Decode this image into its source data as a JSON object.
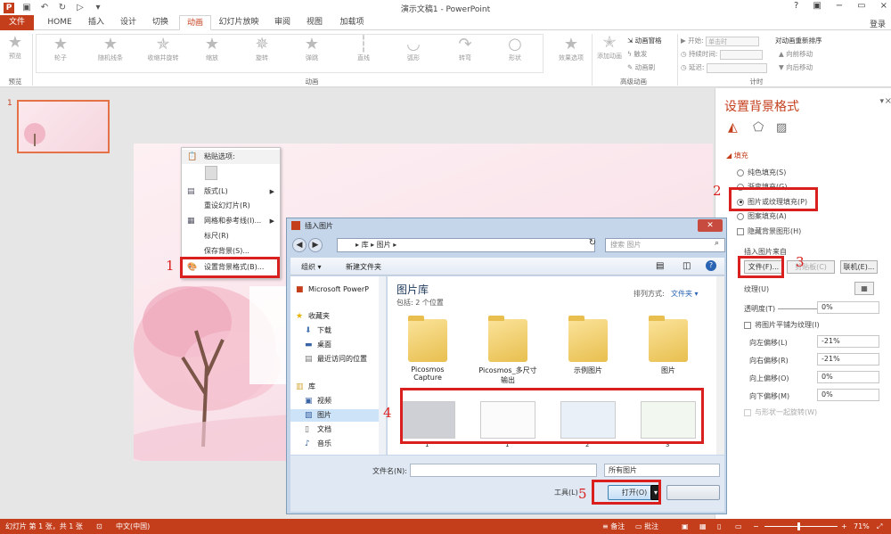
{
  "titlebar": {
    "title": "演示文稿1 - PowerPoint",
    "minimize": "−",
    "restore": "▭",
    "close": "×",
    "help": "?"
  },
  "tabs": [
    "文件",
    "HOME",
    "插入",
    "设计",
    "切换",
    "动画",
    "幻灯片放映",
    "审阅",
    "视图",
    "加载项"
  ],
  "login": "登录",
  "ribbon": {
    "preview": "预览",
    "preview_group": "预览",
    "effects": [
      "轮子",
      "随机线条",
      "收缩并旋转",
      "缩放",
      "旋转",
      "弹跳",
      "直线",
      "弧形",
      "转弯",
      "形状"
    ],
    "animation_group": "动画",
    "effect_options": "效果选项",
    "add_animation": "添加动画",
    "animation_pane": "动画窗格",
    "trigger": "触发",
    "painter": "动画刷",
    "advanced_group": "高级动画",
    "start_label": "开始:",
    "start_value": "单击时",
    "duration_label": "持续时间:",
    "delay_label": "延迟:",
    "timing_group": "计时",
    "reorder": "对动画重新排序",
    "move_earlier": "向前移动",
    "move_later": "向后移动"
  },
  "slide_number": "1",
  "context_menu": {
    "paste_header": "粘贴选项:",
    "items": [
      "版式(L)",
      "重设幻灯片(R)",
      "网格和参考线(I)...",
      "标尺(R)",
      "保存背景(S)...",
      "设置背景格式(B)..."
    ]
  },
  "dialog": {
    "title": "插入图片",
    "close": "✕",
    "path": [
      "库",
      "图片"
    ],
    "search_placeholder": "搜索 图片",
    "organize": "组织 ▾",
    "new_folder": "新建文件夹",
    "nav": {
      "top": "Microsoft PowerP",
      "favorites": "收藏夹",
      "downloads": "下载",
      "desktop": "桌面",
      "recent": "最近访问的位置",
      "libraries": "库",
      "videos": "视频",
      "pictures": "图片",
      "documents": "文档",
      "music": "音乐"
    },
    "library_title": "图片库",
    "library_sub": "包括: 2 个位置",
    "sort_label": "排列方式:",
    "sort_value": "文件夹 ▾",
    "folders": [
      "Picosmos Capture",
      "Picosmos_多尺寸输出",
      "示例图片",
      "图片"
    ],
    "thumb_labels": [
      "1",
      "1",
      "2",
      "3"
    ],
    "filename_label": "文件名(N):",
    "filter_value": "所有图片",
    "tools": "工具(L)",
    "open": "打开(O)"
  },
  "format_pane": {
    "title": "设置背景格式",
    "fill_header": "填充",
    "solid": "纯色填充(S)",
    "gradient": "渐变填充(G)",
    "picture": "图片或纹理填充(P)",
    "pattern": "图案填充(A)",
    "hide_graphics": "隐藏背景图形(H)",
    "insert_from": "插入图片来自",
    "file_btn": "文件(F)...",
    "clipboard_btn": "剪贴板(C)",
    "online_btn": "联机(E)...",
    "texture": "纹理(U)",
    "transparency": "透明度(T)",
    "transparency_value": "0%",
    "tile": "将图片平铺为纹理(I)",
    "offset_left": "向左偏移(L)",
    "offset_left_value": "-21%",
    "offset_right": "向右偏移(R)",
    "offset_right_value": "-21%",
    "offset_top": "向上偏移(O)",
    "offset_top_value": "0%",
    "offset_bottom": "向下偏移(M)",
    "offset_bottom_value": "0%",
    "rotate_with": "与形状一起旋转(W)"
  },
  "markers": [
    "1",
    "2",
    "3",
    "4",
    "5"
  ],
  "statusbar": {
    "slide_info": "幻灯片 第 1 张，共 1 张",
    "language": "中文(中国)",
    "notes": "备注",
    "comments": "批注",
    "zoom": "71%"
  },
  "colors": {
    "accent": "#c43e1c",
    "highlight": "#d9201e"
  }
}
